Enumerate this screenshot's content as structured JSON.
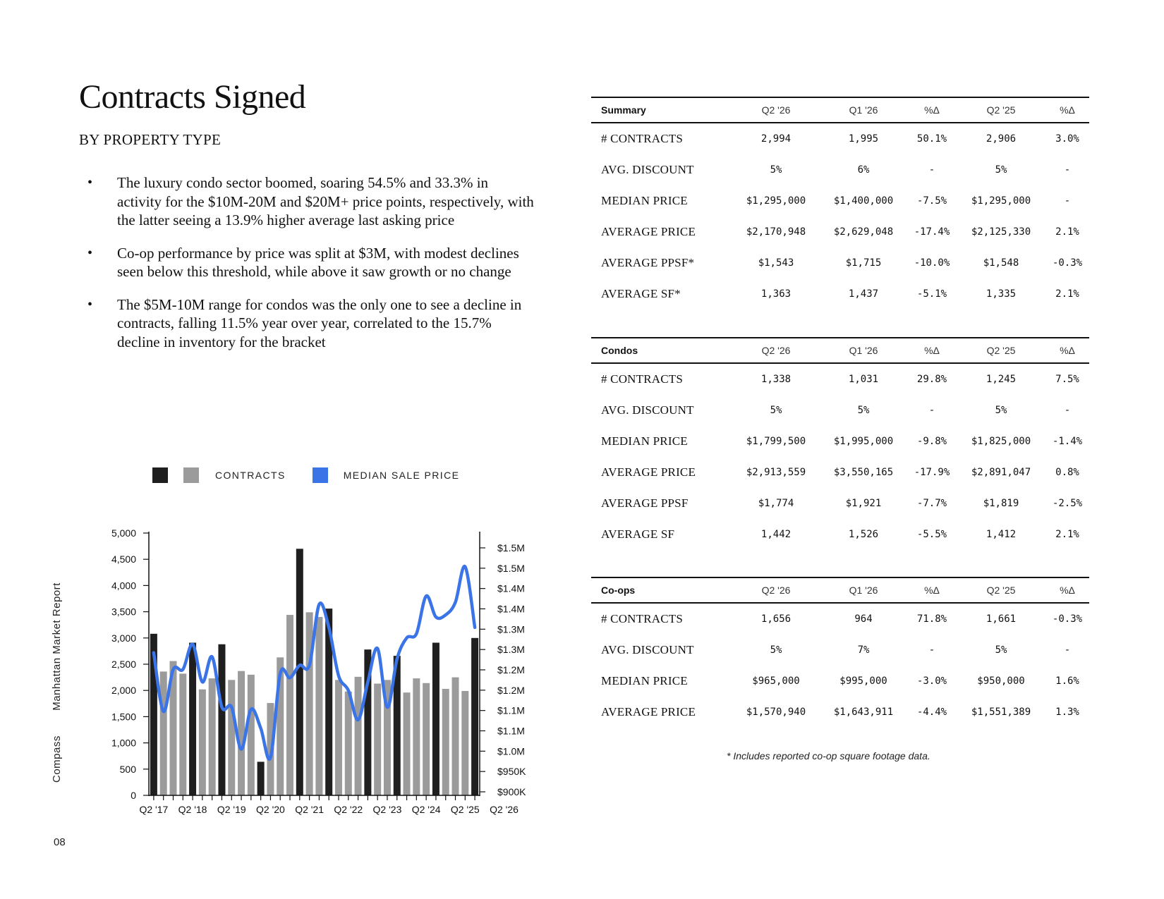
{
  "page": {
    "title": "Contracts Signed",
    "subtitle": "BY PROPERTY TYPE",
    "bullets": [
      "The luxury condo sector boomed, soaring 54.5% and 33.3% in activity for the $10M-20M and $20M+ price points, respectively, with the latter seeing a 13.9% higher average last asking price",
      "Co-op performance by price was split at $3M, with modest declines seen below this threshold, while above it saw growth or no change",
      "The $5M-10M range for condos was the only one to see a decline in contracts, falling 11.5% year over year, correlated to the 15.7% decline in inventory for the bracket"
    ],
    "side_brand": "Compass",
    "side_report": "Manhattan Market Report",
    "page_number": "08",
    "footnote": "* Includes reported co-op square footage data."
  },
  "legend": {
    "contracts_label": "CONTRACTS",
    "median_label": "MEDIAN SALE PRICE",
    "colors": {
      "dark": "#1f1f1f",
      "gray": "#9b9b9b",
      "blue": "#3b74e6"
    }
  },
  "chart_data": {
    "type": "bar",
    "x_tick_labels": [
      "Q2 '17",
      "Q2 '18",
      "Q2 '19",
      "Q2 '20",
      "Q2 '21",
      "Q2 '22",
      "Q2 '23",
      "Q2 '24",
      "Q2 '25",
      "Q2 '26"
    ],
    "y_left_ticks": [
      "5,000",
      "4,500",
      "4,000",
      "3,500",
      "3,000",
      "2,500",
      "2,000",
      "1,500",
      "1,000",
      "500",
      "0"
    ],
    "y_right_ticks": [
      "$1.5M",
      "$1.5M",
      "$1.4M",
      "$1.4M",
      "$1.3M",
      "$1.3M",
      "$1.2M",
      "$1.2M",
      "$1.1M",
      "$1.1M",
      "$1.0M",
      "$950K",
      "$900K"
    ],
    "ylim_left": [
      0,
      5000
    ],
    "ylim_right": [
      900000,
      1525000
    ],
    "series": [
      {
        "type": "bar",
        "values": [
          3080,
          2360,
          2560,
          2320,
          2910,
          2020,
          2230,
          2880,
          2200,
          2370,
          2300,
          640,
          1760,
          2630,
          3440,
          4700,
          3490,
          3400,
          3560,
          2200,
          1980,
          2260,
          2780,
          2130,
          2200,
          2660,
          1960,
          2230,
          2140,
          2910,
          2030,
          2250,
          1990,
          3000
        ],
        "highlight": [
          true,
          false,
          false,
          false,
          true,
          false,
          false,
          true,
          false,
          false,
          false,
          true,
          false,
          false,
          false,
          true,
          false,
          false,
          true,
          false,
          false,
          false,
          true,
          false,
          false,
          true,
          false,
          false,
          false,
          true,
          false,
          false,
          false,
          true
        ]
      },
      {
        "type": "line",
        "values": [
          1240000,
          1100000,
          1200000,
          1200000,
          1260000,
          1170000,
          1230000,
          1110000,
          1110000,
          1010000,
          1105000,
          1060000,
          990000,
          1190000,
          1180000,
          1210000,
          1210000,
          1355000,
          1300000,
          1185000,
          1150000,
          1080000,
          1170000,
          1250000,
          1110000,
          1225000,
          1275000,
          1285000,
          1375000,
          1325000,
          1330000,
          1360000,
          1445000,
          1300000
        ]
      }
    ]
  },
  "tables": [
    {
      "title": "Summary",
      "headers": [
        "Q2 '26",
        "Q1 '26",
        "%Δ",
        "Q2 '25",
        "%Δ"
      ],
      "rows": [
        [
          "# CONTRACTS",
          "2,994",
          "1,995",
          "50.1%",
          "2,906",
          "3.0%"
        ],
        [
          "AVG. DISCOUNT",
          "5%",
          "6%",
          "-",
          "5%",
          "-"
        ],
        [
          "MEDIAN PRICE",
          "$1,295,000",
          "$1,400,000",
          "-7.5%",
          "$1,295,000",
          "-"
        ],
        [
          "AVERAGE PRICE",
          "$2,170,948",
          "$2,629,048",
          "-17.4%",
          "$2,125,330",
          "2.1%"
        ],
        [
          "AVERAGE PPSF*",
          "$1,543",
          "$1,715",
          "-10.0%",
          "$1,548",
          "-0.3%"
        ],
        [
          "AVERAGE SF*",
          "1,363",
          "1,437",
          "-5.1%",
          "1,335",
          "2.1%"
        ]
      ]
    },
    {
      "title": "Condos",
      "headers": [
        "Q2 '26",
        "Q1 '26",
        "%Δ",
        "Q2 '25",
        "%Δ"
      ],
      "rows": [
        [
          "# CONTRACTS",
          "1,338",
          "1,031",
          "29.8%",
          "1,245",
          "7.5%"
        ],
        [
          "AVG. DISCOUNT",
          "5%",
          "5%",
          "-",
          "5%",
          "-"
        ],
        [
          "MEDIAN PRICE",
          "$1,799,500",
          "$1,995,000",
          "-9.8%",
          "$1,825,000",
          "-1.4%"
        ],
        [
          "AVERAGE PRICE",
          "$2,913,559",
          "$3,550,165",
          "-17.9%",
          "$2,891,047",
          "0.8%"
        ],
        [
          "AVERAGE PPSF",
          "$1,774",
          "$1,921",
          "-7.7%",
          "$1,819",
          "-2.5%"
        ],
        [
          "AVERAGE SF",
          "1,442",
          "1,526",
          "-5.5%",
          "1,412",
          "2.1%"
        ]
      ]
    },
    {
      "title": "Co-ops",
      "headers": [
        "Q2 '26",
        "Q1 '26",
        "%Δ",
        "Q2 '25",
        "%Δ"
      ],
      "rows": [
        [
          "# CONTRACTS",
          "1,656",
          "964",
          "71.8%",
          "1,661",
          "-0.3%"
        ],
        [
          "AVG. DISCOUNT",
          "5%",
          "7%",
          "-",
          "5%",
          "-"
        ],
        [
          "MEDIAN PRICE",
          "$965,000",
          "$995,000",
          "-3.0%",
          "$950,000",
          "1.6%"
        ],
        [
          "AVERAGE PRICE",
          "$1,570,940",
          "$1,643,911",
          "-4.4%",
          "$1,551,389",
          "1.3%"
        ]
      ]
    }
  ]
}
